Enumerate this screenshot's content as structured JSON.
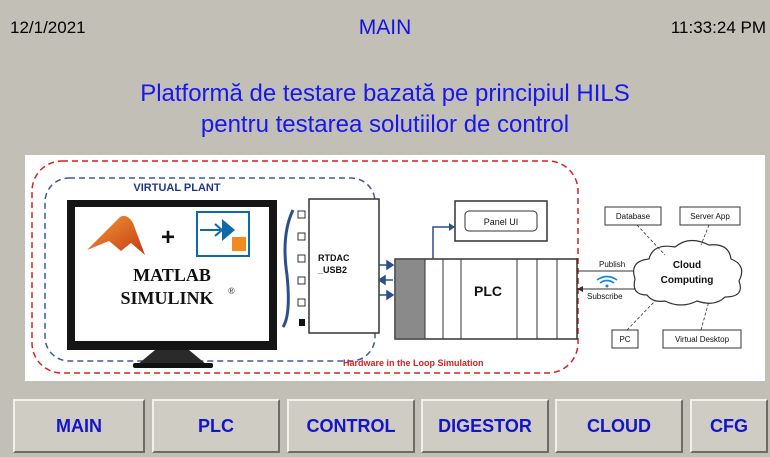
{
  "header": {
    "date": "12/1/2021",
    "title": "MAIN",
    "time": "11:33:24 PM"
  },
  "heading": {
    "line1": "Platformă de testare bazată pe principiul HILS",
    "line2": "pentru testarea solutiilor de control"
  },
  "diagram": {
    "virtual_plant": "VIRTUAL PLANT",
    "plus": "+",
    "matlab": "MATLAB",
    "simulink": "SIMULINK",
    "reg": "®",
    "rtdac_line1": "RTDAC",
    "rtdac_line2": "_USB2",
    "panel_ui": "Panel UI",
    "plc": "PLC",
    "publish": "Publish",
    "subscribe": "Subscribe",
    "cloud_line1": "Cloud",
    "cloud_line2": "Computing",
    "database": "Database",
    "server_app": "Server App",
    "pc": "PC",
    "virtual_desktop": "Virtual Desktop",
    "hils_label": "Hardware in the Loop Simulation"
  },
  "nav": {
    "main": "MAIN",
    "plc": "PLC",
    "control": "CONTROL",
    "digestor": "DIGESTOR",
    "cloud": "CLOUD",
    "cfg": "CFG"
  },
  "colors": {
    "background": "#c2bfb6",
    "title_blue": "#1212e6",
    "nav_text": "#1414c8",
    "hils_red": "#d42020",
    "plant_blue": "#3c5a9a"
  }
}
